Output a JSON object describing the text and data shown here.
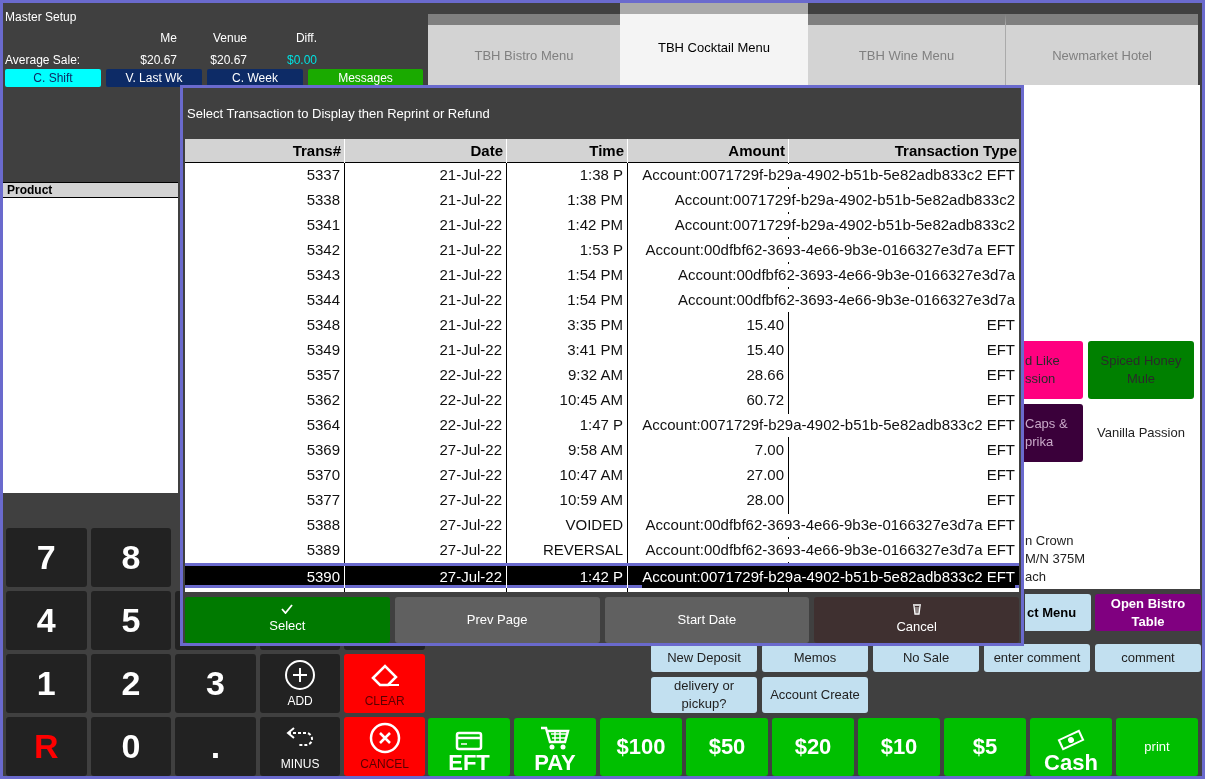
{
  "header": {
    "title": "Master Setup",
    "columns": [
      "Me",
      "Venue",
      "Diff."
    ],
    "row_label": "Average Sale:",
    "values": [
      "$20.67",
      "$20.67",
      "$0.00"
    ]
  },
  "view_buttons": [
    {
      "label": "C. Shift",
      "selected": true
    },
    {
      "label": "V. Last Wk",
      "selected": false
    },
    {
      "label": "C. Week",
      "selected": false
    }
  ],
  "messages_button": "Messages",
  "product_panel": {
    "heading": "Product"
  },
  "keypad": [
    [
      {
        "kind": "digit",
        "label": "7"
      },
      {
        "kind": "digit",
        "label": "8"
      }
    ],
    [
      {
        "kind": "digit",
        "label": "4"
      },
      {
        "kind": "digit",
        "label": "5"
      },
      {
        "kind": "blank"
      },
      {
        "kind": "blank"
      },
      {
        "kind": "blank"
      }
    ],
    [
      {
        "kind": "digit",
        "label": "1"
      },
      {
        "kind": "digit",
        "label": "2"
      },
      {
        "kind": "digit",
        "label": "3"
      },
      {
        "kind": "add",
        "label": "ADD"
      },
      {
        "kind": "clear",
        "label": "CLEAR"
      }
    ],
    [
      {
        "kind": "red_digit",
        "label": "R"
      },
      {
        "kind": "digit",
        "label": "0"
      },
      {
        "kind": "digit",
        "label": "."
      },
      {
        "kind": "minus",
        "label": "MINUS"
      },
      {
        "kind": "cancel",
        "label": "CANCEL"
      }
    ]
  ],
  "tabs": [
    {
      "label": "TBH Bistro Menu",
      "selected": false
    },
    {
      "label": "TBH Cocktail Menu",
      "selected": true
    },
    {
      "label": "TBH Wine Menu",
      "selected": false
    },
    {
      "label": "Newmarket Hotel",
      "selected": false
    }
  ],
  "menu_items": [
    {
      "kind": "button",
      "lines": [
        "d Like",
        "ssion"
      ],
      "color": "#ff0080"
    },
    {
      "kind": "button",
      "lines": [
        "Spiced Honey",
        "Mule"
      ],
      "color": "#008000"
    },
    {
      "kind": "button",
      "lines": [
        "Caps &",
        "prika"
      ],
      "color": "#3a003a"
    },
    {
      "kind": "text",
      "lines": [
        "Vanilla Passion"
      ]
    }
  ],
  "menu_note": [
    "n Crown",
    "M/N 375M",
    "ach"
  ],
  "function_rows": [
    [
      {
        "kind": "partial",
        "label": "ct Menu"
      },
      {
        "kind": "purple",
        "label": "Open Bistro Table"
      }
    ],
    [
      {
        "kind": "light",
        "label": "New Deposit"
      },
      {
        "kind": "light",
        "label": "Memos"
      },
      {
        "kind": "light",
        "label": "No Sale"
      },
      {
        "kind": "light",
        "label": "enter comment"
      },
      {
        "kind": "light",
        "label": "comment"
      }
    ],
    [
      {
        "kind": "light",
        "label": "delivery or pickup?"
      },
      {
        "kind": "light",
        "label": "Account Create"
      }
    ]
  ],
  "tender_buttons": [
    {
      "kind": "eft",
      "label": "EFT"
    },
    {
      "kind": "pay",
      "label": "PAY"
    },
    {
      "kind": "amount",
      "label": "$100"
    },
    {
      "kind": "amount",
      "label": "$50"
    },
    {
      "kind": "amount",
      "label": "$20"
    },
    {
      "kind": "amount",
      "label": "$10"
    },
    {
      "kind": "amount",
      "label": "$5"
    },
    {
      "kind": "cash",
      "label": "Cash"
    },
    {
      "kind": "print",
      "label": "print"
    }
  ],
  "dialog": {
    "title": "Select Transaction to Display then Reprint or Refund",
    "columns": [
      "Trans#",
      "Date",
      "Time",
      "Amount",
      "Transaction Type"
    ],
    "rows": [
      {
        "trans": "5337",
        "date": "21-Jul-22",
        "time": "1:38 P",
        "type": "Account:0071729f-b29a-4902-b51b-5e82adb833c2 EFT",
        "selected": false
      },
      {
        "trans": "5338",
        "date": "21-Jul-22",
        "time": "1:38 PM",
        "type": "Account:0071729f-b29a-4902-b51b-5e82adb833c2",
        "selected": false
      },
      {
        "trans": "5341",
        "date": "21-Jul-22",
        "time": "1:42 PM",
        "type": "Account:0071729f-b29a-4902-b51b-5e82adb833c2",
        "selected": false
      },
      {
        "trans": "5342",
        "date": "21-Jul-22",
        "time": "1:53 P",
        "type": "Account:00dfbf62-3693-4e66-9b3e-0166327e3d7a EFT",
        "selected": false
      },
      {
        "trans": "5343",
        "date": "21-Jul-22",
        "time": "1:54 PM",
        "type": "Account:00dfbf62-3693-4e66-9b3e-0166327e3d7a",
        "selected": false
      },
      {
        "trans": "5344",
        "date": "21-Jul-22",
        "time": "1:54 PM",
        "type": "Account:00dfbf62-3693-4e66-9b3e-0166327e3d7a",
        "selected": false
      },
      {
        "trans": "5348",
        "date": "21-Jul-22",
        "time": "3:35 PM",
        "amount": "15.40",
        "type": "EFT",
        "selected": false
      },
      {
        "trans": "5349",
        "date": "21-Jul-22",
        "time": "3:41 PM",
        "amount": "15.40",
        "type": "EFT",
        "selected": false
      },
      {
        "trans": "5357",
        "date": "22-Jul-22",
        "time": "9:32 AM",
        "amount": "28.66",
        "type": "EFT",
        "selected": false
      },
      {
        "trans": "5362",
        "date": "22-Jul-22",
        "time": "10:45 AM",
        "amount": "60.72",
        "type": "EFT",
        "selected": false
      },
      {
        "trans": "5364",
        "date": "22-Jul-22",
        "time": "1:47 P",
        "type": "Account:0071729f-b29a-4902-b51b-5e82adb833c2 EFT",
        "selected": false
      },
      {
        "trans": "5369",
        "date": "27-Jul-22",
        "time": "9:58 AM",
        "amount": "7.00",
        "type": "EFT",
        "selected": false
      },
      {
        "trans": "5370",
        "date": "27-Jul-22",
        "time": "10:47 AM",
        "amount": "27.00",
        "type": "EFT",
        "selected": false
      },
      {
        "trans": "5377",
        "date": "27-Jul-22",
        "time": "10:59 AM",
        "amount": "28.00",
        "type": "EFT",
        "selected": false
      },
      {
        "trans": "5388",
        "date": "27-Jul-22",
        "time": "VOIDED",
        "type": "Account:00dfbf62-3693-4e66-9b3e-0166327e3d7a EFT",
        "selected": false
      },
      {
        "trans": "5389",
        "date": "27-Jul-22",
        "time": "REVERSAL",
        "type": "Account:00dfbf62-3693-4e66-9b3e-0166327e3d7a EFT",
        "selected": false
      },
      {
        "trans": "5390",
        "date": "27-Jul-22",
        "time": "1:42 P",
        "type": "Account:0071729f-b29a-4902-b51b-5e82adb833c2 EFT",
        "selected": true
      }
    ],
    "buttons": [
      {
        "kind": "select",
        "label": "Select"
      },
      {
        "kind": "plain",
        "label": "Prev Page"
      },
      {
        "kind": "plain",
        "label": "Start Date"
      },
      {
        "kind": "cancel",
        "label": "Cancel"
      }
    ]
  }
}
